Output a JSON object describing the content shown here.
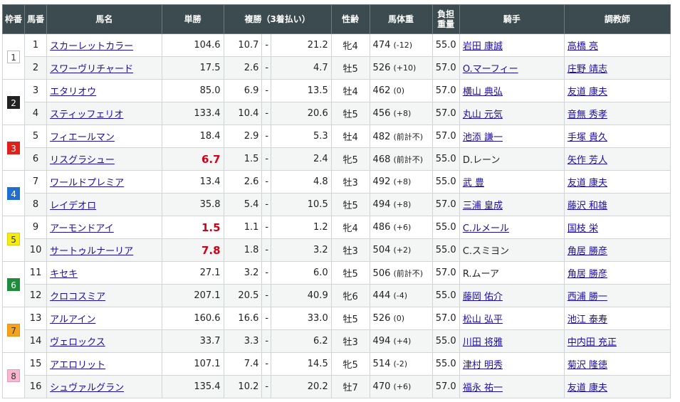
{
  "headers": {
    "waku": "枠番",
    "umaban": "馬番",
    "name": "馬名",
    "win": "単勝",
    "place": "複勝（3着払い）",
    "sex_age": "性齢",
    "weight": "馬体重",
    "burden_line1": "負担",
    "burden_line2": "重量",
    "jockey": "騎手",
    "trainer": "調教師"
  },
  "waku_colors": {
    "1": {
      "bg": "#ffffff",
      "fg": "#333333",
      "border": "#bbbbbb"
    },
    "2": {
      "bg": "#222222",
      "fg": "#ffffff",
      "border": "#222222"
    },
    "3": {
      "bg": "#e0201b",
      "fg": "#ffffff",
      "border": "#e0201b"
    },
    "4": {
      "bg": "#1f6fd1",
      "fg": "#ffffff",
      "border": "#1f6fd1"
    },
    "5": {
      "bg": "#f6ec12",
      "fg": "#333333",
      "border": "#d7ce0a"
    },
    "6": {
      "bg": "#1e8c3a",
      "fg": "#ffffff",
      "border": "#1e8c3a"
    },
    "7": {
      "bg": "#f7a21b",
      "fg": "#333333",
      "border": "#e6920c"
    },
    "8": {
      "bg": "#f7b7cf",
      "fg": "#333333",
      "border": "#e79ab8"
    }
  },
  "rows": [
    {
      "waku": "1",
      "num": "1",
      "name": "スカーレットカラー",
      "win": "104.6",
      "fav": false,
      "place_lo": "10.7",
      "place_hi": "21.2",
      "sex_age": "牝4",
      "weight": "474",
      "weight_diff": "(-12)",
      "burden": "55.0",
      "jockey": "岩田 康誠",
      "jockey_link": true,
      "trainer": "高橋 亮"
    },
    {
      "waku": "",
      "num": "2",
      "name": "スワーヴリチャード",
      "win": "17.5",
      "fav": false,
      "place_lo": "2.6",
      "place_hi": "4.7",
      "sex_age": "牡5",
      "weight": "526",
      "weight_diff": "(+10)",
      "burden": "57.0",
      "jockey": "O.マーフィー",
      "jockey_link": true,
      "trainer": "庄野 靖志"
    },
    {
      "waku": "2",
      "num": "3",
      "name": "エタリオウ",
      "win": "85.0",
      "fav": false,
      "place_lo": "6.9",
      "place_hi": "13.5",
      "sex_age": "牡4",
      "weight": "462",
      "weight_diff": "(0)",
      "burden": "57.0",
      "jockey": "横山 典弘",
      "jockey_link": true,
      "trainer": "友道 康夫"
    },
    {
      "waku": "",
      "num": "4",
      "name": "スティッフェリオ",
      "win": "133.4",
      "fav": false,
      "place_lo": "10.4",
      "place_hi": "20.6",
      "sex_age": "牡5",
      "weight": "456",
      "weight_diff": "(+8)",
      "burden": "57.0",
      "jockey": "丸山 元気",
      "jockey_link": true,
      "trainer": "音無 秀孝"
    },
    {
      "waku": "3",
      "num": "5",
      "name": "フィエールマン",
      "win": "18.4",
      "fav": false,
      "place_lo": "2.9",
      "place_hi": "5.3",
      "sex_age": "牡4",
      "weight": "482",
      "weight_diff": "(前計不)",
      "burden": "57.0",
      "jockey": "池添 謙一",
      "jockey_link": true,
      "trainer": "手塚 貴久"
    },
    {
      "waku": "",
      "num": "6",
      "name": "リスグラシュー",
      "win": "6.7",
      "fav": true,
      "place_lo": "1.5",
      "place_hi": "2.4",
      "sex_age": "牝5",
      "weight": "468",
      "weight_diff": "(前計不)",
      "burden": "55.0",
      "jockey": "D.レーン",
      "jockey_link": false,
      "trainer": "矢作 芳人"
    },
    {
      "waku": "4",
      "num": "7",
      "name": "ワールドプレミア",
      "win": "13.4",
      "fav": false,
      "place_lo": "2.6",
      "place_hi": "4.8",
      "sex_age": "牡3",
      "weight": "492",
      "weight_diff": "(+8)",
      "burden": "55.0",
      "jockey": "武 豊",
      "jockey_link": true,
      "trainer": "友道 康夫"
    },
    {
      "waku": "",
      "num": "8",
      "name": "レイデオロ",
      "win": "35.8",
      "fav": false,
      "place_lo": "5.4",
      "place_hi": "10.5",
      "sex_age": "牡5",
      "weight": "494",
      "weight_diff": "(+8)",
      "burden": "57.0",
      "jockey": "三浦 皇成",
      "jockey_link": true,
      "trainer": "藤沢 和雄"
    },
    {
      "waku": "5",
      "num": "9",
      "name": "アーモンドアイ",
      "win": "1.5",
      "fav": true,
      "place_lo": "1.1",
      "place_hi": "1.2",
      "sex_age": "牝4",
      "weight": "486",
      "weight_diff": "(+6)",
      "burden": "55.0",
      "jockey": "C.ルメール",
      "jockey_link": true,
      "trainer": "国枝 栄"
    },
    {
      "waku": "",
      "num": "10",
      "name": "サートゥルナーリア",
      "win": "7.8",
      "fav": true,
      "place_lo": "1.8",
      "place_hi": "3.2",
      "sex_age": "牡3",
      "weight": "504",
      "weight_diff": "(+2)",
      "burden": "55.0",
      "jockey": "C.スミヨン",
      "jockey_link": false,
      "trainer": "角居 勝彦"
    },
    {
      "waku": "6",
      "num": "11",
      "name": "キセキ",
      "win": "27.1",
      "fav": false,
      "place_lo": "3.2",
      "place_hi": "6.0",
      "sex_age": "牡5",
      "weight": "506",
      "weight_diff": "(前計不)",
      "burden": "57.0",
      "jockey": "R.ムーア",
      "jockey_link": false,
      "trainer": "角居 勝彦"
    },
    {
      "waku": "",
      "num": "12",
      "name": "クロコスミア",
      "win": "207.1",
      "fav": false,
      "place_lo": "20.5",
      "place_hi": "40.9",
      "sex_age": "牝6",
      "weight": "444",
      "weight_diff": "(-4)",
      "burden": "55.0",
      "jockey": "藤岡 佑介",
      "jockey_link": true,
      "trainer": "西浦 勝一"
    },
    {
      "waku": "7",
      "num": "13",
      "name": "アルアイン",
      "win": "160.6",
      "fav": false,
      "place_lo": "16.6",
      "place_hi": "33.0",
      "sex_age": "牡5",
      "weight": "526",
      "weight_diff": "(0)",
      "burden": "57.0",
      "jockey": "松山 弘平",
      "jockey_link": true,
      "trainer": "池江 泰寿"
    },
    {
      "waku": "",
      "num": "14",
      "name": "ヴェロックス",
      "win": "33.7",
      "fav": false,
      "place_lo": "3.3",
      "place_hi": "6.2",
      "sex_age": "牡3",
      "weight": "494",
      "weight_diff": "(+4)",
      "burden": "55.0",
      "jockey": "川田 将雅",
      "jockey_link": true,
      "trainer": "中内田 充正"
    },
    {
      "waku": "8",
      "num": "15",
      "name": "アエロリット",
      "win": "107.1",
      "fav": false,
      "place_lo": "7.4",
      "place_hi": "14.5",
      "sex_age": "牝5",
      "weight": "514",
      "weight_diff": "(-2)",
      "burden": "55.0",
      "jockey": "津村 明秀",
      "jockey_link": true,
      "trainer": "菊沢 隆徳"
    },
    {
      "waku": "",
      "num": "16",
      "name": "シュヴァルグラン",
      "win": "135.4",
      "fav": false,
      "place_lo": "10.2",
      "place_hi": "20.2",
      "sex_age": "牡7",
      "weight": "470",
      "weight_diff": "(+6)",
      "burden": "57.0",
      "jockey": "福永 祐一",
      "jockey_link": true,
      "trainer": "友道 康夫"
    }
  ]
}
